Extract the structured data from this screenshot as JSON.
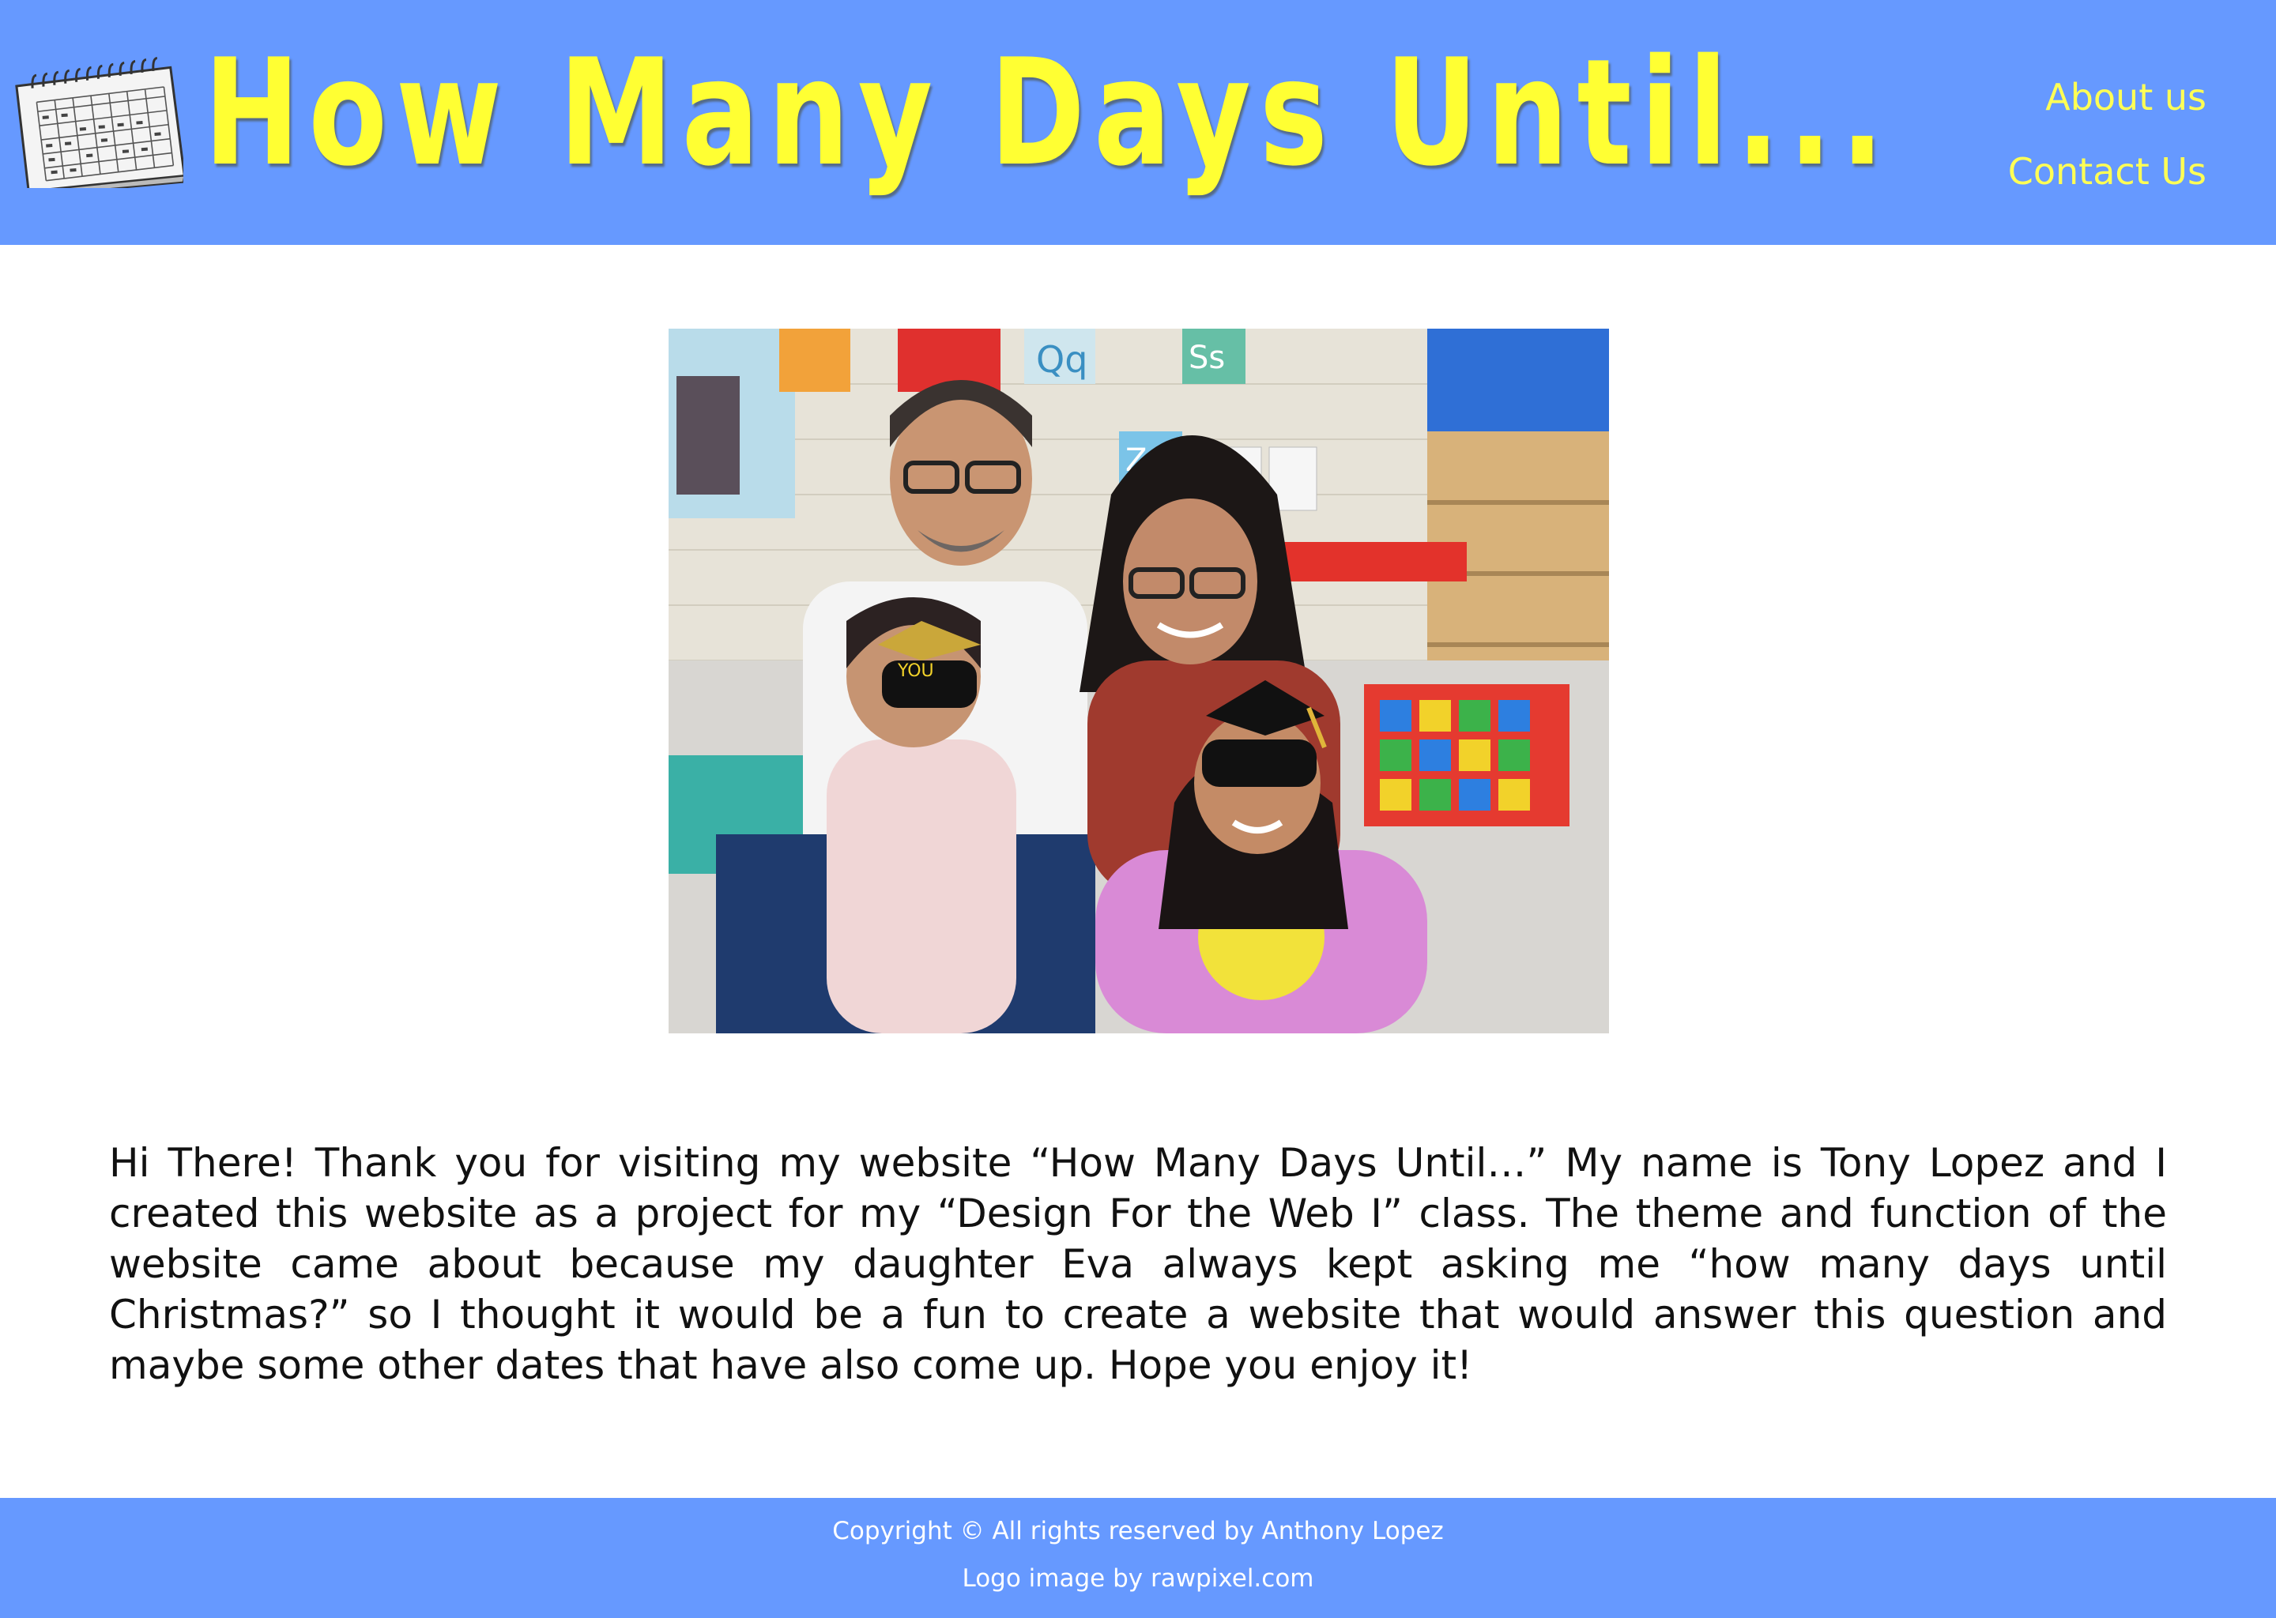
{
  "header": {
    "title": "How Many Days Until...",
    "logo_icon": "calendar-icon",
    "nav": [
      {
        "label": "About us"
      },
      {
        "label": "Contact Us"
      }
    ]
  },
  "main": {
    "photo_icon": "family-photo",
    "intro": "Hi There! Thank you for visiting my website “How Many Days Until…” My name is Tony Lopez and I created this website as a project for my “Design For the Web I” class. The theme and function of the website came about because my daughter Eva always kept asking me “how many days until Christmas?” so I thought it would be a fun to create a website that would answer this question and maybe some other dates that have also come up. Hope you enjoy it!"
  },
  "footer": {
    "copyright": "Copyright © All rights reserved by Anthony Lopez",
    "credit": "Logo image by rawpixel.com"
  },
  "colors": {
    "header_bg": "#6699ff",
    "title": "#ffff33",
    "nav_link": "#ffff55",
    "footer_text": "#ffffff",
    "body_text": "#111111"
  }
}
